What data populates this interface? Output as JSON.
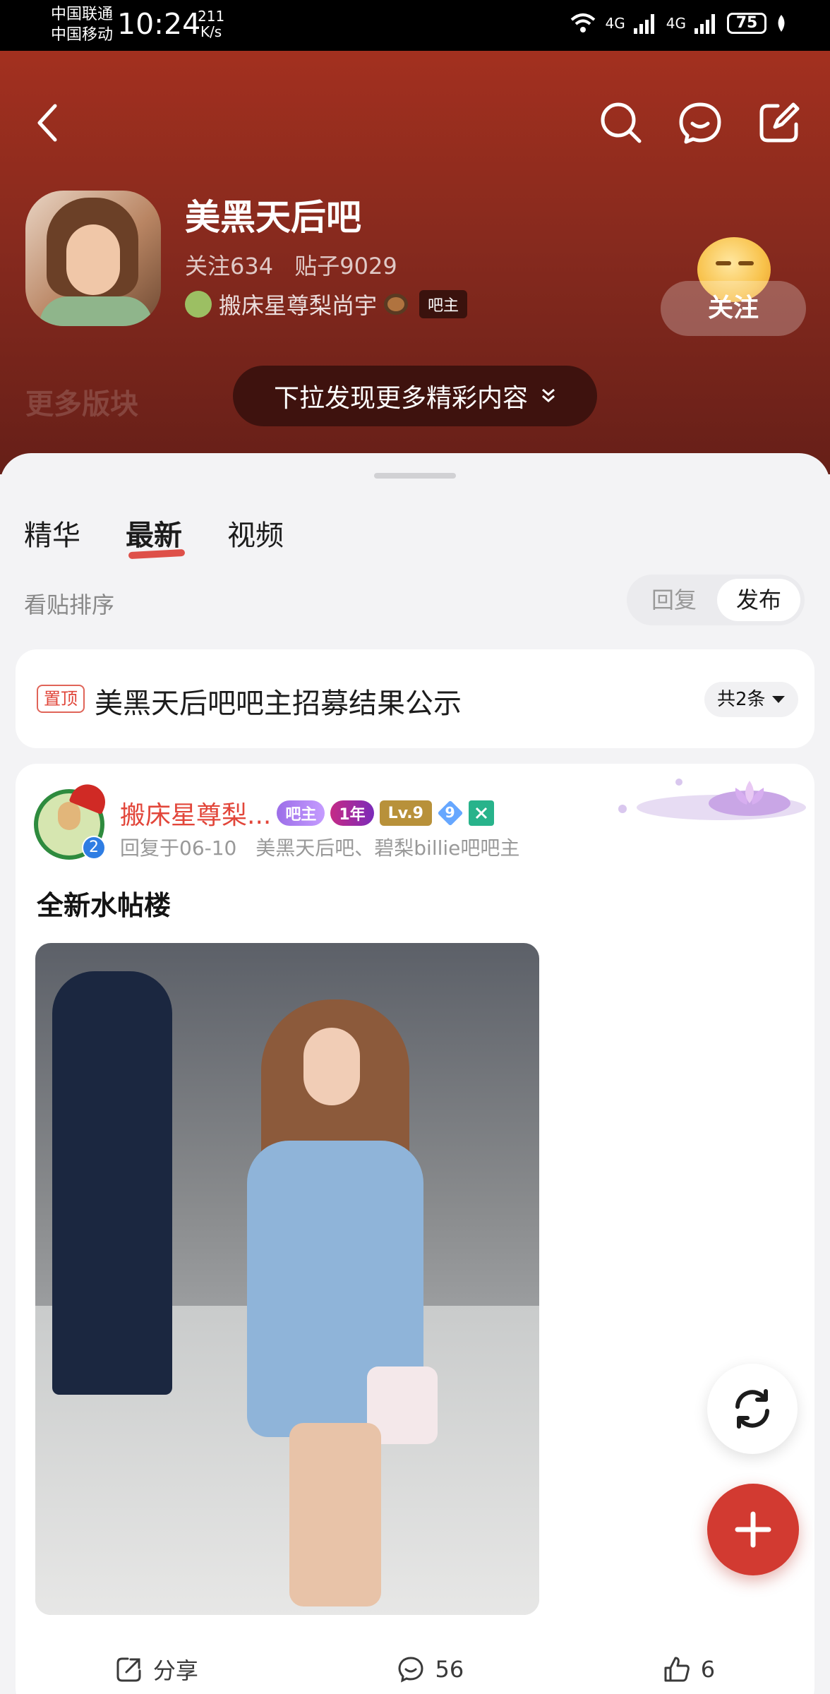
{
  "status_bar": {
    "carrier_1": "中国联通",
    "carrier_2": "中国移动",
    "time": "10:24",
    "speed_value": "211",
    "speed_unit": "K/s",
    "net_1": "4G",
    "net_2": "4G",
    "battery": "75"
  },
  "forum": {
    "name": "美黑天后吧",
    "follow_stat": "关注634",
    "posts_stat": "贴子9029",
    "owner_name": "搬床星尊梨尚宇",
    "owner_badge": "吧主",
    "follow_button": "关注",
    "more_sections": "更多版块",
    "pull_hint": "下拉发现更多精彩内容"
  },
  "tabs": [
    "精华",
    "最新",
    "视频"
  ],
  "sort": {
    "label": "看贴排序",
    "reply": "回复",
    "publish": "发布"
  },
  "pinned": {
    "tag": "置顶",
    "title": "美黑天后吧吧主招募结果公示",
    "count": "共2条"
  },
  "post": {
    "author": "搬床星尊梨...",
    "avatar_number": "2",
    "badge_owner": "吧主",
    "badge_year": "1年",
    "badge_level": "Lv.9",
    "badge_gem": "9",
    "reply_time": "回复于06-10",
    "owner_of": "美黑天后吧、碧梨billie吧吧主",
    "title": "全新水帖楼",
    "share_label": "分享",
    "comment_count": "56",
    "like_count": "6"
  },
  "colors": {
    "header_top": "#a3301f",
    "header_bottom": "#661f18",
    "accent_red": "#d23a31",
    "author_red": "#e2463a"
  }
}
